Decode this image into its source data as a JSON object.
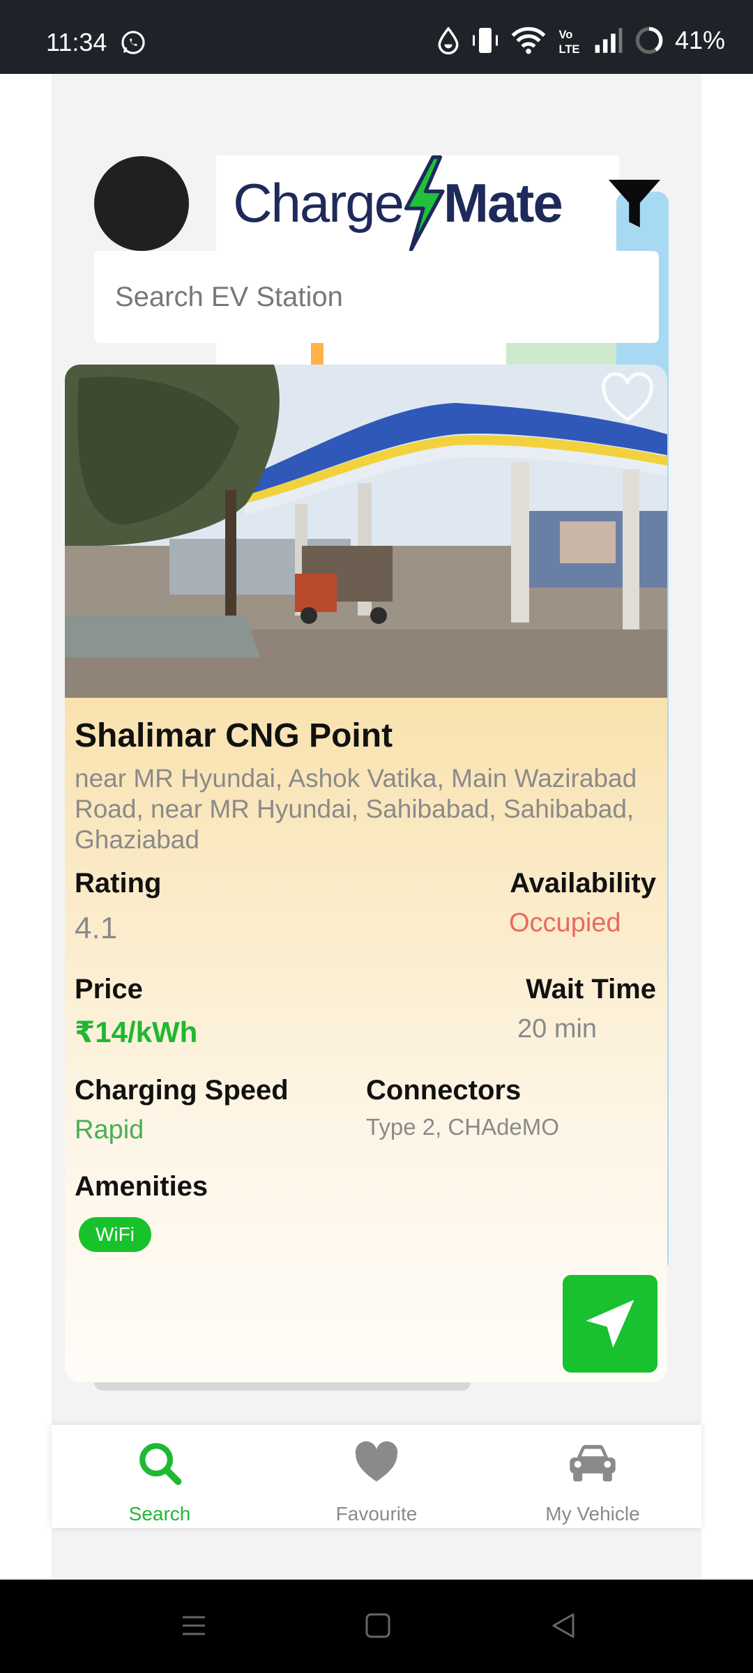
{
  "status_bar": {
    "time": "11:34",
    "battery": "41%",
    "icons": [
      "whatsapp-icon",
      "water-drop-icon",
      "vibrate-icon",
      "wifi-icon",
      "volte-icon",
      "signal-icon",
      "battery-ring-icon"
    ]
  },
  "header": {
    "logo_part1": "Charge",
    "logo_part2": "Mate",
    "search_placeholder": "Search EV Station"
  },
  "station": {
    "name": "Shalimar CNG Point",
    "address": "near MR Hyundai, Ashok Vatika, Main Wazirabad Road, near MR Hyundai, Sahibabad, Sahibabad, Ghaziabad",
    "rating_label": "Rating",
    "rating_value": "4.1",
    "availability_label": "Availability",
    "availability_value": "Occupied",
    "price_label": "Price",
    "price_value": "₹14/kWh",
    "wait_label": "Wait Time",
    "wait_value": "20 min",
    "speed_label": "Charging Speed",
    "speed_value": "Rapid",
    "connectors_label": "Connectors",
    "connectors_value": "Type 2, CHAdeMO",
    "amenities_label": "Amenities",
    "amenities": [
      "WiFi"
    ]
  },
  "tabs": [
    {
      "label": "Search",
      "icon": "search-icon",
      "active": true
    },
    {
      "label": "Favourite",
      "icon": "heart-icon",
      "active": false
    },
    {
      "label": "My Vehicle",
      "icon": "car-icon",
      "active": false
    }
  ],
  "colors": {
    "accent_green": "#1fb832",
    "occupied_red": "#e86a5f",
    "logo_navy": "#1e2a5a"
  }
}
